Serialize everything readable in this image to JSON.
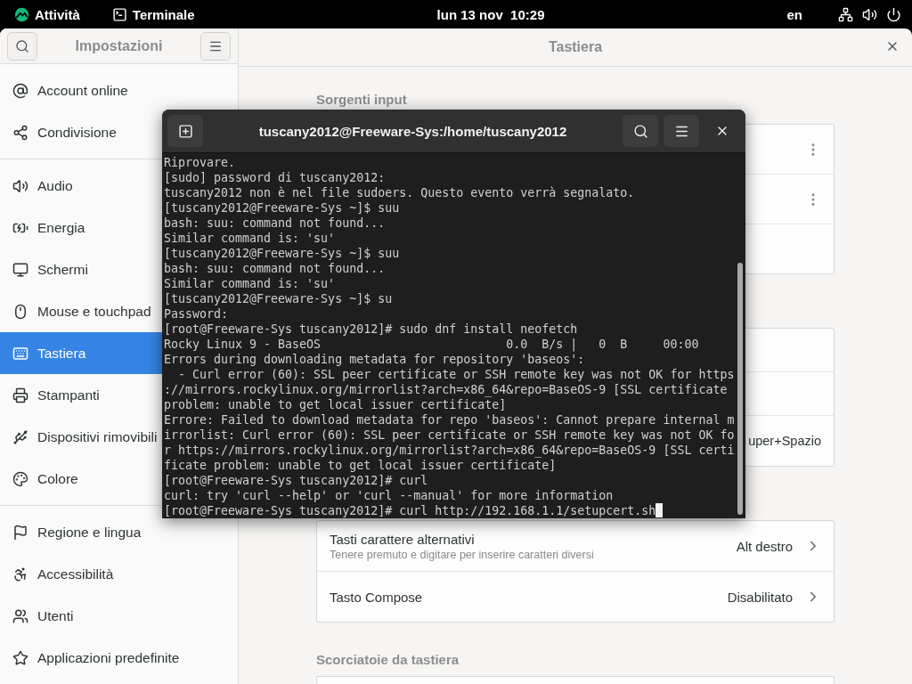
{
  "top_bar": {
    "activities": "Attività",
    "app": "Terminale",
    "clock": "lun 13 nov  10:29",
    "keyboard_layout": "en"
  },
  "settings": {
    "sidebar": {
      "title": "Impostazioni",
      "groups": [
        [
          {
            "label": "Account online",
            "selected": false
          },
          {
            "label": "Condivisione",
            "selected": false
          }
        ],
        [
          {
            "label": "Audio",
            "selected": false
          },
          {
            "label": "Energia",
            "selected": false
          },
          {
            "label": "Schermi",
            "selected": false
          },
          {
            "label": "Mouse e touchpad",
            "selected": false
          },
          {
            "label": "Tastiera",
            "selected": true
          },
          {
            "label": "Stampanti",
            "selected": false
          },
          {
            "label": "Dispositivi rimovibili",
            "selected": false
          },
          {
            "label": "Colore",
            "selected": false
          }
        ],
        [
          {
            "label": "Regione e lingua",
            "selected": false
          },
          {
            "label": "Accessibilità",
            "selected": false
          },
          {
            "label": "Utenti",
            "selected": false
          },
          {
            "label": "Applicazioni predefinite",
            "selected": false
          }
        ]
      ]
    },
    "panel": {
      "title": "Tastiera",
      "sections": [
        {
          "heading": "Sorgenti input",
          "rows": [
            {
              "kind": "menu"
            },
            {
              "kind": "menu"
            },
            {
              "kind": "empty"
            }
          ]
        },
        {
          "rows": [
            {
              "kind": "empty"
            },
            {
              "kind": "empty"
            },
            {
              "kind": "value",
              "value": "uper+Spazio"
            }
          ]
        },
        {
          "rows": [
            {
              "kind": "link",
              "title": "Tasti carattere alternativi",
              "subtitle": "Tenere premuto e digitare per inserire caratteri diversi",
              "value": "Alt destro"
            },
            {
              "kind": "link",
              "title": "Tasto Compose",
              "value": "Disabilitato"
            }
          ]
        },
        {
          "heading": "Scorciatoie da tastiera"
        }
      ]
    }
  },
  "terminal": {
    "title": "tuscany2012@Freeware-Sys:/home/tuscany2012",
    "lines": [
      "Riprovare.",
      "[sudo] password di tuscany2012:",
      "tuscany2012 non è nel file sudoers. Questo evento verrà segnalato.",
      "[tuscany2012@Freeware-Sys ~]$ suu",
      "bash: suu: command not found...",
      "Similar command is: 'su'",
      "[tuscany2012@Freeware-Sys ~]$ suu",
      "bash: suu: command not found...",
      "Similar command is: 'su'",
      "[tuscany2012@Freeware-Sys ~]$ su",
      "Password:",
      "[root@Freeware-Sys tuscany2012]# sudo dnf install neofetch",
      "Rocky Linux 9 - BaseOS                          0.0  B/s |   0  B     00:00",
      "Errors during downloading metadata for repository 'baseos':",
      "  - Curl error (60): SSL peer certificate or SSH remote key was not OK for https",
      "://mirrors.rockylinux.org/mirrorlist?arch=x86_64&repo=BaseOS-9 [SSL certificate",
      "problem: unable to get local issuer certificate]",
      "Errore: Failed to download metadata for repo 'baseos': Cannot prepare internal m",
      "irrorlist: Curl error (60): SSL peer certificate or SSH remote key was not OK fo",
      "r https://mirrors.rockylinux.org/mirrorlist?arch=x86_64&repo=BaseOS-9 [SSL certi",
      "ficate problem: unable to get local issuer certificate]",
      "[root@Freeware-Sys tuscany2012]# curl",
      "curl: try 'curl --help' or 'curl --manual' for more information",
      "[root@Freeware-Sys tuscany2012]# curl http://192.168.1.1/setupcert.sh"
    ]
  }
}
